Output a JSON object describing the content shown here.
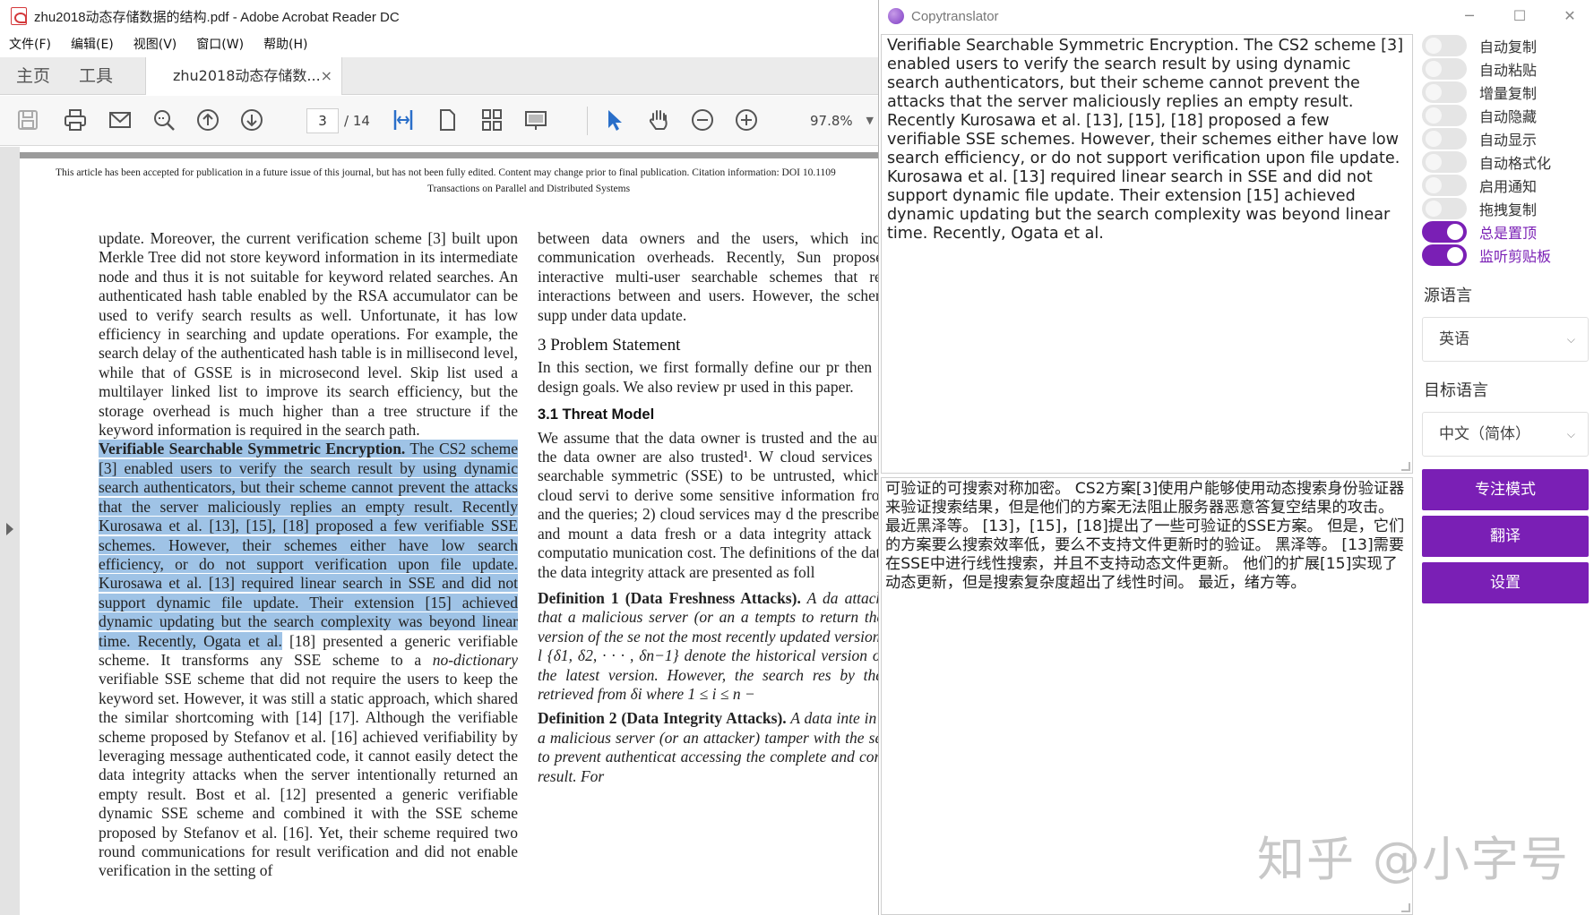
{
  "acrobat": {
    "window_title": "zhu2018动态存储数据的结构.pdf - Adobe Acrobat Reader DC",
    "menu": [
      "文件(F)",
      "编辑(E)",
      "视图(V)",
      "窗口(W)",
      "帮助(H)"
    ],
    "tabs": {
      "home": "主页",
      "tools": "工具",
      "doc": "zhu2018动态存储数...",
      "doc_close": "×"
    },
    "toolbar": {
      "page_current": "3",
      "page_total": "/ 14",
      "zoom": "97.8%"
    },
    "notice": {
      "line1": "This article has been accepted for publication in a future issue of this journal, but has not been fully edited. Content may change prior to final publication. Citation information: DOI 10.1109",
      "line2": "Transactions on Parallel and Distributed Systems"
    },
    "left_column": {
      "intro": "update. Moreover, the current verification scheme [3] built upon Merkle Tree did not store keyword information in its intermediate node and thus it is not suitable for keyword related searches. An authenticated hash table enabled by the RSA accumulator can be used to verify search results as well. Unfortunate, it has low efficiency in searching and update operations. For example, the search delay of the authenticated hash table is in millisecond level, while that of GSSE is in microsecond level. Skip list used a multilayer linked list to improve its search efficiency, but the storage overhead is much higher than a tree structure if the keyword information is required in the search path.",
      "highlight_heading": "Verifiable Searchable Symmetric Encryption.",
      "highlight_body": " The CS2 scheme [3] enabled users to verify the search result by using dynamic search authenticators, but their scheme cannot prevent the attacks that the server maliciously replies an empty result. Recently Kurosawa et al. [13], [15], [18] proposed a few verifiable SSE schemes. However, their schemes either have low search efficiency, or do not support verification upon file update. Kurosawa et al. [13] required linear search in SSE and did not support dynamic file update. Their extension [15] achieved dynamic updating but the search complexity was beyond linear time. Recently, Ogata et al.",
      "rest_a": "[18] presented a generic verifiable scheme. It transforms any SSE scheme to a ",
      "rest_italic": "no-dictionary",
      "rest_b": " verifiable SSE scheme that did not require the users to keep the keyword set. However, it was still a static approach, which shared the similar shortcoming with [14] [17]. Although the verifiable scheme proposed by Stefanov et al. [16] achieved verifiability by leveraging message authenticated code, it cannot easily detect the data integrity attacks when the server intentionally returned an empty result. Bost et al. [12] presented a generic verifiable dynamic SSE scheme and combined it with the SSE scheme proposed by Stefanov et al. [16]. Yet, their scheme required two round communications for result verification and did not enable verification in the setting of"
    },
    "right_column": {
      "intro": "between data owners and the users, which incurs essary communication overheads. Recently, Sun proposed a non-interactive multi-user searchable schemes that reduced the interactions between and users. However, the scheme did not supp under data update.",
      "section_heading": "3 Problem Statement",
      "section_body": "In this section, we first formally define our pr then present our design goals. We also review pr used in this paper.",
      "subsection_heading": "3.1 Threat Model",
      "subsection_body": "We assume that the data owner is trusted and the authorized by the data owner are also trusted¹. W cloud services performing searchable symmetric (SSE) to be untrusted, which means 1) cloud servi to derive some sensitive information from the data and the queries; 2) cloud services may d the prescribed protocols and mount a data fresh or a data integrity attack to save its computatio munication cost. The definitions of the data fresh and the data integrity attack are presented as foll",
      "def1_heading": "Definition 1 (Data Freshness Attacks).",
      "def1_body": " A da attack in SSE is that a malicious server (or an a tempts to return the historical version of the se not the most recently updated version. Formally, l {δ1, δ2, · · · , δn−1} denote the historical version of and δn is the latest version. However, the search res by the server is retrieved from δi where 1 ≤ i ≤ n −",
      "def2_heading": "Definition 2 (Data Integrity Attacks).",
      "def2_body": " A data inte in SSE is that a malicious server (or an attacker) tamper with the search result to prevent authenticat accessing the complete and correct search result. For"
    }
  },
  "copytranslator": {
    "window_title": "Copytranslator",
    "window_buttons": [
      "─",
      "☐",
      "✕"
    ],
    "source_text": "Verifiable Searchable Symmetric Encryption. The CS2 scheme [3] enabled users to verify the search result by using dynamic search authenticators, but their scheme cannot prevent the attacks that the server maliciously replies an empty result. Recently Kurosawa et al. [13], [15], [18] proposed a few verifiable SSE schemes. However, their schemes either have low search efficiency, or do not support verification upon file update. Kurosawa et al. [13] required linear search in SSE and did not support dynamic file update. Their extension [15] achieved dynamic updating but the search complexity was beyond linear time. Recently, Ogata et al.",
    "translated_text": "可验证的可搜索对称加密。 CS2方案[3]使用户能够使用动态搜索身份验证器来验证搜索结果，但是他们的方案无法阻止服务器恶意答复空结果的攻击。 最近黑泽等。 [13]，[15]，[18]提出了一些可验证的SSE方案。 但是，它们的方案要么搜索效率低，要么不支持文件更新时的验证。 黑泽等。 [13]需要在SSE中进行线性搜索，并且不支持动态文件更新。 他们的扩展[15]实现了动态更新，但是搜索复杂度超出了线性时间。 最近，绪方等。",
    "toggles": [
      {
        "label": "自动复制",
        "on": false
      },
      {
        "label": "自动粘贴",
        "on": false
      },
      {
        "label": "增量复制",
        "on": false
      },
      {
        "label": "自动隐藏",
        "on": false
      },
      {
        "label": "自动显示",
        "on": false
      },
      {
        "label": "自动格式化",
        "on": false
      },
      {
        "label": "启用通知",
        "on": false
      },
      {
        "label": "拖拽复制",
        "on": false
      },
      {
        "label": "总是置顶",
        "on": true
      },
      {
        "label": "监听剪贴板",
        "on": true
      }
    ],
    "source_lang_label": "源语言",
    "source_lang_value": "英语",
    "target_lang_label": "目标语言",
    "target_lang_value": "中文（简体）",
    "buttons": {
      "focus": "专注模式",
      "translate": "翻译",
      "settings": "设置"
    },
    "accent_color": "#7a1fb5"
  },
  "watermark": "知乎 @小字号"
}
